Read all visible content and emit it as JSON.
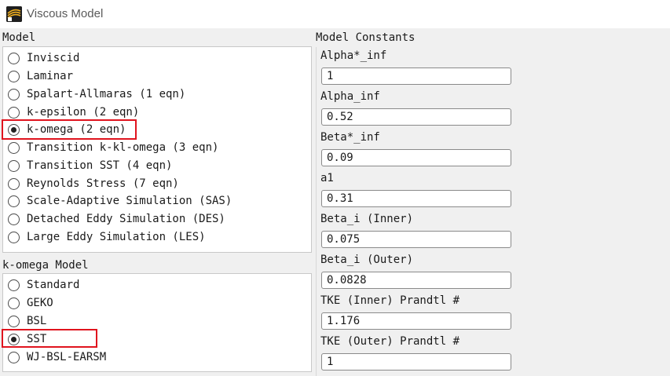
{
  "window": {
    "title": "Viscous Model"
  },
  "model": {
    "label": "Model",
    "options": [
      {
        "label": "Inviscid",
        "checked": false
      },
      {
        "label": "Laminar",
        "checked": false
      },
      {
        "label": "Spalart-Allmaras (1 eqn)",
        "checked": false
      },
      {
        "label": "k-epsilon (2 eqn)",
        "checked": false
      },
      {
        "label": "k-omega (2 eqn)",
        "checked": true
      },
      {
        "label": "Transition k-kl-omega (3 eqn)",
        "checked": false
      },
      {
        "label": "Transition SST (4 eqn)",
        "checked": false
      },
      {
        "label": "Reynolds Stress (7 eqn)",
        "checked": false
      },
      {
        "label": "Scale-Adaptive Simulation (SAS)",
        "checked": false
      },
      {
        "label": "Detached Eddy Simulation (DES)",
        "checked": false
      },
      {
        "label": "Large Eddy Simulation (LES)",
        "checked": false
      }
    ]
  },
  "komega_model": {
    "label": "k-omega Model",
    "options": [
      {
        "label": "Standard",
        "checked": false
      },
      {
        "label": "GEKO",
        "checked": false
      },
      {
        "label": "BSL",
        "checked": false
      },
      {
        "label": "SST",
        "checked": true
      },
      {
        "label": "WJ-BSL-EARSM",
        "checked": false
      }
    ]
  },
  "constants": {
    "label": "Model Constants",
    "items": [
      {
        "label": "Alpha*_inf",
        "value": "1"
      },
      {
        "label": "Alpha_inf",
        "value": "0.52"
      },
      {
        "label": "Beta*_inf",
        "value": "0.09"
      },
      {
        "label": "a1",
        "value": "0.31"
      },
      {
        "label": "Beta_i (Inner)",
        "value": "0.075"
      },
      {
        "label": "Beta_i (Outer)",
        "value": "0.0828"
      },
      {
        "label": "TKE (Inner) Prandtl #",
        "value": "1.176"
      },
      {
        "label": "TKE (Outer) Prandtl #",
        "value": "1"
      }
    ]
  },
  "colors": {
    "highlight": "#e0141e"
  }
}
